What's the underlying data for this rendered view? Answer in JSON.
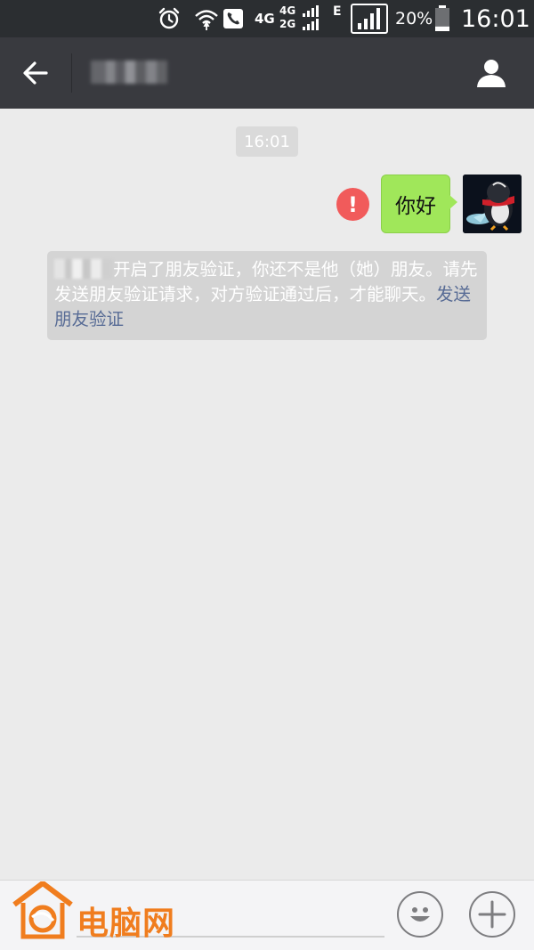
{
  "status_bar": {
    "network_4g": "4G",
    "dual_top": "4G",
    "dual_bottom": "2G",
    "edge": "E",
    "battery_percent": "20%",
    "time": "16:01",
    "battery_level": 0.2
  },
  "top_bar": {
    "back_icon": "arrow-left-icon",
    "profile_icon": "person-icon"
  },
  "chat": {
    "timestamp": "16:01",
    "outgoing_message": "你好",
    "send_failed_mark": "!",
    "system_notice": {
      "text": "开启了朋友验证，你还不是他（她）朋友。请先发送朋友验证请求，对方验证通过后，才能聊天。",
      "link": "发送朋友验证"
    }
  },
  "input_bar": {
    "emoji_icon": "smiley-icon",
    "more_icon": "plus-icon"
  },
  "watermark": {
    "text": "电脑网"
  },
  "colors": {
    "status_bar": "#2b2e31",
    "top_bar": "#393a3f",
    "chat_background": "#ebebeb",
    "outgoing_bubble": "#a0e75a",
    "error": "#f15b5b",
    "link": "#576b95",
    "watermark": "#f07d1e"
  }
}
